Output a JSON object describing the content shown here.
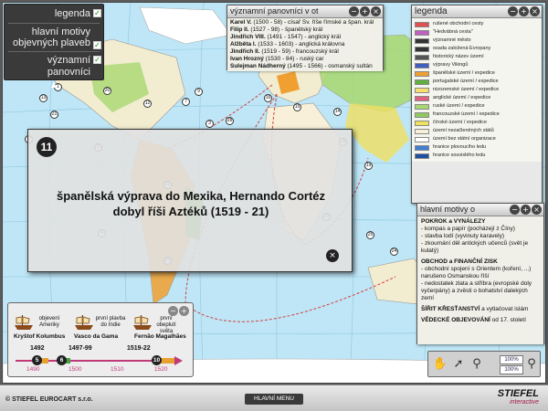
{
  "topleft_menu": [
    {
      "label": "legenda",
      "checked": true
    },
    {
      "label": "hlavní motivy objevných plaveb",
      "checked": true
    },
    {
      "label": "významní panovníci",
      "checked": true
    }
  ],
  "rulers": {
    "title": "významní panovníci v ot",
    "items": [
      {
        "name": "Karel V.",
        "text": " (1500 - 58) - císař Sv. říše římské a špan. král"
      },
      {
        "name": "Filip II.",
        "text": " (1527 - 98) - španělský král"
      },
      {
        "name": "Jindřich VIII.",
        "text": " (1491 - 1547) - anglický král"
      },
      {
        "name": "Alžběta I.",
        "text": " (1533 - 1603) - anglická královna"
      },
      {
        "name": "Jindřich II.",
        "text": " (1519 - 59) - francouzský král"
      },
      {
        "name": "Ivan Hrozný",
        "text": " (1530 - 84) - ruský car"
      },
      {
        "name": "Sulejman Nádherný",
        "text": " (1495 - 1566) - osmanský sultán"
      }
    ]
  },
  "legend": {
    "title": "legenda",
    "items": [
      {
        "label": "rušené obchodní cesty",
        "color": "#e05050"
      },
      {
        "label": "\"Hedvábná cesta\"",
        "color": "#c060c0"
      },
      {
        "label": "významné město",
        "color": "#333333"
      },
      {
        "label": "osada založená Evropany",
        "color": "#333333"
      },
      {
        "label": "historický název území",
        "color": "#555555"
      },
      {
        "label": "výpravy Vikingů",
        "color": "#4060c0"
      },
      {
        "label": "španělské území / expedice",
        "color": "#f0a030"
      },
      {
        "label": "portugalské území / expedice",
        "color": "#60b040"
      },
      {
        "label": "nizozemské území / expedice",
        "color": "#f8e070"
      },
      {
        "label": "anglické území / expedice",
        "color": "#e06080"
      },
      {
        "label": "ruské území / expedice",
        "color": "#a8d870"
      },
      {
        "label": "francouzské území / expedice",
        "color": "#90c860"
      },
      {
        "label": "čínské území / expedice",
        "color": "#f0e060"
      },
      {
        "label": "území nezačleněných států",
        "color": "#f8f0d8"
      },
      {
        "label": "území bez státní organizace",
        "color": "#ffffff"
      },
      {
        "label": "hranice plovoucího ledu",
        "color": "#4080d0"
      },
      {
        "label": "hranice souvislého ledu",
        "color": "#2050a0"
      }
    ]
  },
  "motives": {
    "title": "hlavní motivy o",
    "sections": [
      {
        "heading": "POKROK a VYNÁLEZY",
        "lines": [
          "- kompas a papír (pocházejí z Číny)",
          "- stavba lodí (vyvinuty karavely)",
          "- zkoumání děl antických učenců (svět je kulatý)"
        ]
      },
      {
        "heading": "OBCHOD a FINANČNÍ ZISK",
        "lines": [
          "- obchodní spojení s Orientem (koření, ...) narušeno Osmanskou říší",
          "- nedostatek zlata a stříbra (evropské doly vyčerpány) a zvěsti o bohatství dalekých zemí"
        ]
      },
      {
        "heading": "ŠÍŘIT KŘESŤANSTVÍ",
        "tail": " a vytlačovat islám",
        "lines": []
      },
      {
        "heading": "VĚDECKÉ OBJEVOVÁNÍ",
        "tail": " od 17. století",
        "lines": []
      }
    ]
  },
  "info": {
    "number": "11",
    "text": "španělská výprava do Mexika, Hernando Cortéz dobyl říši Aztéků (1519 - 21)"
  },
  "timeline": {
    "explorers": [
      {
        "desc": "objevení Ameriky",
        "name": "Kryštof Kolumbus",
        "year": "1492",
        "num": "5",
        "color": "#e8a030"
      },
      {
        "desc": "první plavba do Indie",
        "name": "Vasco da Gama",
        "year": "1497-99",
        "num": "6",
        "color": "#48a040"
      },
      {
        "desc": "první obeplutí světa",
        "name": "Fernão Magalhães",
        "year": "1519-22",
        "num": "10",
        "color": "#e8a030"
      }
    ],
    "scale": [
      "1490",
      "1500",
      "1510",
      "1520"
    ]
  },
  "toolbox": {
    "zoom1": "100%",
    "zoom2": "100%"
  },
  "footer": {
    "copyright": "© STIEFEL EUROCART s.r.o.",
    "menu": "HLAVNÍ MENU",
    "logo1": "STIEFEL",
    "logo2": "interactive"
  },
  "map_numbers": [
    "1",
    "2",
    "3",
    "4",
    "7",
    "8",
    "9",
    "12",
    "13",
    "14",
    "15",
    "16",
    "17",
    "18",
    "19",
    "20",
    "21",
    "22",
    "23",
    "24",
    "25",
    "27",
    "28"
  ]
}
